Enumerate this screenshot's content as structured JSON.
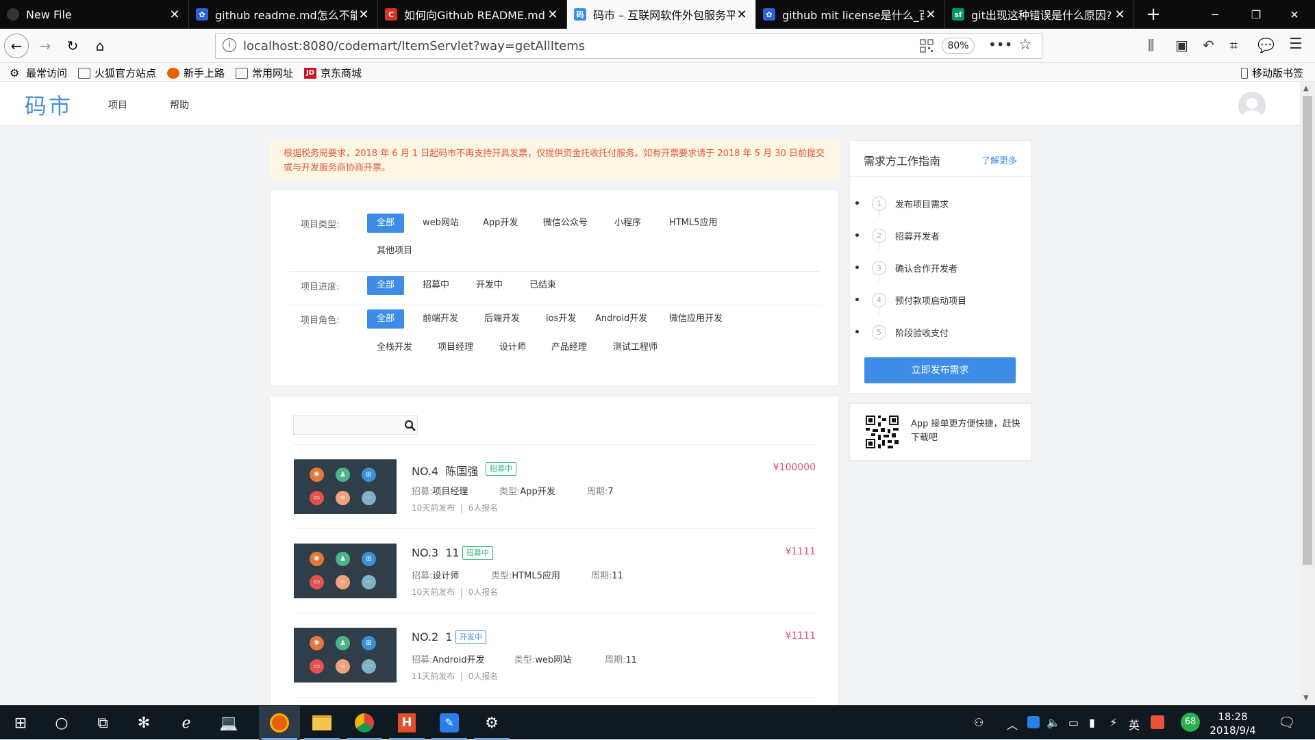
{
  "browser": {
    "tabs": [
      {
        "title": "New File",
        "icon": "github-icon",
        "active": false
      },
      {
        "title": "github readme.md怎么不能用",
        "icon": "baidu-paw-icon",
        "active": false
      },
      {
        "title": "如何向Github README.md中",
        "icon": "csdn-icon",
        "active": false
      },
      {
        "title": "码市 – 互联网软件外包服务平台",
        "icon": "codemart-icon",
        "active": true
      },
      {
        "title": "github mit license是什么_百度",
        "icon": "baidu-paw-icon",
        "active": false
      },
      {
        "title": "git出现这种错误是什么原因? - ",
        "icon": "segmentfault-icon",
        "active": false
      }
    ],
    "url": "localhost:8080/codemart/ItemServlet?way=getAllItems",
    "zoom": "80%",
    "bookmarks": [
      "最常访问",
      "火狐官方站点",
      "新手上路",
      "常用网址",
      "京东商城"
    ],
    "mobile_bookmarks": "移动版书签"
  },
  "site": {
    "logo": "码市",
    "nav": [
      "项目",
      "帮助"
    ],
    "notice": "根据税务局要求，2018 年 6 月 1 日起码市不再支持开具发票，仅提供资金托收托付服务。如有开票要求请于 2018 年 5 月 30 日前提交或与开发服务商协商开票。",
    "filters": {
      "type_label": "项目类型:",
      "type_options": [
        "全部",
        "web网站",
        "App开发",
        "微信公众号",
        "小程序",
        "HTML5应用",
        "其他项目"
      ],
      "progress_label": "项目进度:",
      "progress_options": [
        "全部",
        "招募中",
        "开发中",
        "已结束"
      ],
      "role_label": "项目角色:",
      "role_options": [
        "全部",
        "前端开发",
        "后端开发",
        "ios开发",
        "Android开发",
        "微信应用开发",
        "全栈开发",
        "项目经理",
        "设计师",
        "产品经理",
        "测试工程师"
      ]
    },
    "search": {
      "placeholder": "",
      "value": ""
    },
    "items": [
      {
        "no": "NO.4",
        "name": "陈国强",
        "status": "招募中",
        "price": "¥100000",
        "recruit_label": "招募:",
        "recruit": "项目经理",
        "type_label": "类型:",
        "type": "App开发",
        "period_label": "周期:",
        "period": "7",
        "published": "10天前发布",
        "applicants": "6人报名"
      },
      {
        "no": "NO.3",
        "name": "11",
        "status": "招募中",
        "price": "¥1111",
        "recruit_label": "招募:",
        "recruit": "设计师",
        "type_label": "类型:",
        "type": "HTML5应用",
        "period_label": "周期:",
        "period": "11",
        "published": "10天前发布",
        "applicants": "0人报名"
      },
      {
        "no": "NO.2",
        "name": "1",
        "status": "开发中",
        "price": "¥1111",
        "recruit_label": "招募:",
        "recruit": "Android开发",
        "type_label": "类型:",
        "type": "web网站",
        "period_label": "周期:",
        "period": "11",
        "published": "11天前发布",
        "applicants": "0人报名"
      }
    ],
    "guide": {
      "title": "需求方工作指南",
      "more": "了解更多",
      "steps": [
        {
          "num": "1",
          "label": "发布项目需求"
        },
        {
          "num": "2",
          "label": "招募开发者"
        },
        {
          "num": "3",
          "label": "确认合作开发者"
        },
        {
          "num": "4",
          "label": "预付款项启动项目"
        },
        {
          "num": "5",
          "label": "阶段验收支付"
        }
      ],
      "button": "立即发布需求"
    },
    "app_promo": "App 接单更方便快捷，赶快下载吧"
  },
  "taskbar": {
    "time": "18:28",
    "date": "2018/9/4",
    "ime": "英",
    "battery_badge": "68"
  },
  "colors": {
    "accent": "#3d8ce6",
    "price": "#e54a78",
    "notice_bg": "#fdf6e3",
    "notice_text": "#e2563e",
    "recruit": "#36b37e"
  }
}
